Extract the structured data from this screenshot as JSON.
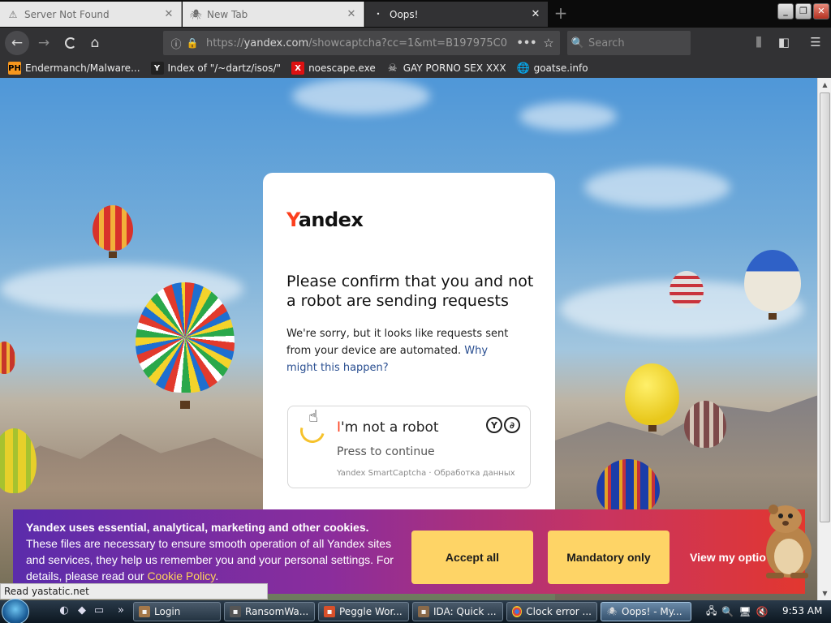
{
  "tabs": [
    {
      "label": "Server Not Found",
      "icon": "warning-icon",
      "active": false
    },
    {
      "label": "New Tab",
      "icon": "spider-icon",
      "active": false
    },
    {
      "label": "Oops!",
      "icon": "loading-dot-icon",
      "active": true
    }
  ],
  "window": {
    "minimize": "_",
    "restore": "❐",
    "close": "✕"
  },
  "nav": {
    "url_host": "yandex.com",
    "url_prefix": "https://",
    "url_rest": "/showcaptcha?cc=1&mt=B197975C0",
    "search_placeholder": "Search"
  },
  "bookmarks": [
    {
      "label": "Endermanch/Malware...",
      "icon": "ph-icon"
    },
    {
      "label": "Index of \"/~dartz/isos/\"",
      "icon": "yc-icon"
    },
    {
      "label": "noescape.exe",
      "icon": "x-icon"
    },
    {
      "label": "GAY PORNO SEX XXX",
      "icon": "ghost-icon"
    },
    {
      "label": "goatse.info",
      "icon": "globe-icon"
    }
  ],
  "captcha": {
    "logo_first": "Y",
    "logo_rest": "andex",
    "title": "Please confirm that you and not a robot are sending requests",
    "body": "We're sorry, but it looks like requests sent from your device are automated.",
    "link": "Why might this happen?",
    "checkbox_first": "I",
    "checkbox_rest": "'m not a robot",
    "press": "Press to continue",
    "brand": "Yandex SmartCaptcha · Обработка данных"
  },
  "cookie": {
    "title": "Yandex uses essential, analytical, marketing and other cookies",
    "body": "These files are necessary to ensure smooth operation of all Yandex sites and services, they help us remember you and your personal settings. For details, please read our",
    "policy_link": "Cookie Policy",
    "accept": "Accept all",
    "mandatory": "Mandatory only",
    "view": "View my optio"
  },
  "status_text": "Read yastatic.net",
  "taskbar": {
    "items": [
      {
        "label": "Login",
        "active": false
      },
      {
        "label": "RansomWa...",
        "active": false
      },
      {
        "label": "Peggle Wor...",
        "active": false
      },
      {
        "label": "IDA: Quick ...",
        "active": false
      },
      {
        "label": "Clock error ...",
        "active": false
      },
      {
        "label": "Oops! - My...",
        "active": true
      }
    ],
    "clock": "9:53 AM"
  },
  "colors": {
    "yandex_red": "#fc3f1d",
    "cookie_button": "#fed466",
    "link": "#2a4f91"
  }
}
